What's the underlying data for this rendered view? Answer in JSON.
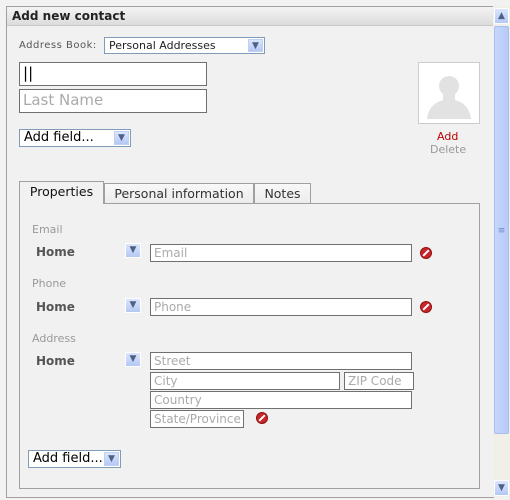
{
  "header": {
    "title": "Add new contact"
  },
  "address_book": {
    "label": "Address Book:",
    "value": "Personal Addresses"
  },
  "name": {
    "first_value": "",
    "last_placeholder": "Last Name"
  },
  "add_field_top": "Add field...",
  "photo": {
    "add": "Add",
    "delete": "Delete"
  },
  "tabs": [
    {
      "label": "Properties"
    },
    {
      "label": "Personal information"
    },
    {
      "label": "Notes"
    }
  ],
  "sections": {
    "email": {
      "title": "Email",
      "type": "Home",
      "placeholder": "Email"
    },
    "phone": {
      "title": "Phone",
      "type": "Home",
      "placeholder": "Phone"
    },
    "address": {
      "title": "Address",
      "type": "Home",
      "street": "Street",
      "city": "City",
      "zip": "ZIP Code",
      "country": "Country",
      "state": "State/Province"
    }
  },
  "add_field_bottom": "Add field...",
  "colors": {
    "accent": "#c00000",
    "select_arrow": "#b4c8f5"
  }
}
